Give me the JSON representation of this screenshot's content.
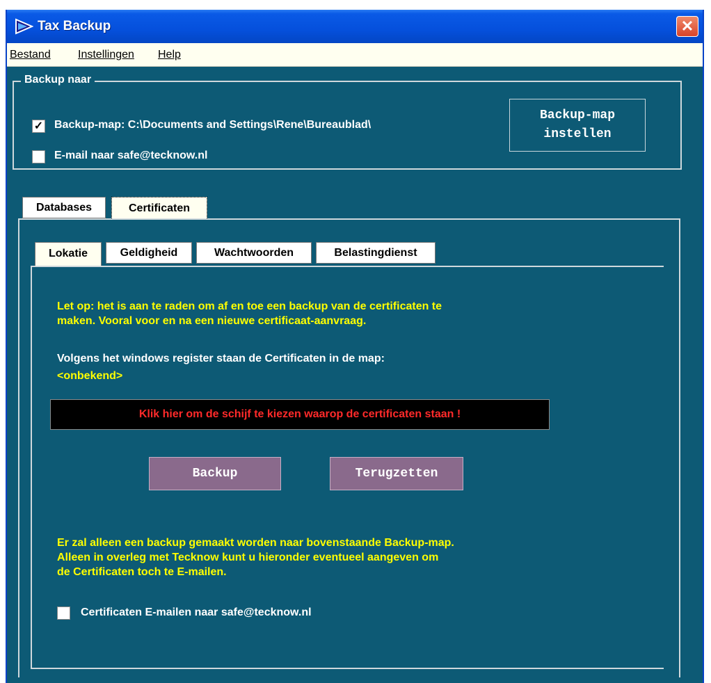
{
  "window": {
    "title": "Tax Backup"
  },
  "menu": {
    "items": [
      "Bestand",
      "Instellingen",
      "Help"
    ]
  },
  "backup_group": {
    "label": "Backup naar",
    "folder_checked": true,
    "folder_label": "Backup-map: C:\\Documents and Settings\\Rene\\Bureaublad\\",
    "email_checked": false,
    "email_label": "E-mail naar safe@tecknow.nl",
    "set_folder_button": [
      "Backup-map",
      "instellen"
    ]
  },
  "main_tabs": [
    {
      "label": "Databases",
      "active": false
    },
    {
      "label": "Certificaten",
      "active": true
    }
  ],
  "sub_tabs": [
    {
      "label": "Lokatie",
      "active": true
    },
    {
      "label": "Geldigheid",
      "active": false
    },
    {
      "label": "Wachtwoorden",
      "active": false
    },
    {
      "label": "Belastingdienst",
      "active": false
    }
  ],
  "panel": {
    "warning": [
      "Let op: het is aan te raden om af en toe een backup van de certificaten te",
      "maken. Vooral voor en na een nieuwe certificaat-aanvraag."
    ],
    "registry_text": "Volgens het windows register staan de Certificaten in de map:",
    "registry_value": "<onbekend>",
    "choose_drive": "Klik hier om de schijf te kiezen waarop de certificaten staan !",
    "backup_button": "Backup",
    "restore_button": "Terugzetten",
    "info": [
      "Er zal alleen een backup gemaakt worden naar bovenstaande Backup-map.",
      "Alleen in overleg met Tecknow kunt u hieronder eventueel aangeven om",
      "de Certificaten toch te E-mailen."
    ],
    "email_certs_checked": false,
    "email_certs_label": "Certificaten E-mailen naar safe@tecknow.nl"
  },
  "colors": {
    "background": "#0d5a75",
    "titlebar": "#0550dc",
    "warning_text": "#ffff00",
    "alert_text": "#ff2a2a",
    "action_button": "#8a6a8c"
  }
}
